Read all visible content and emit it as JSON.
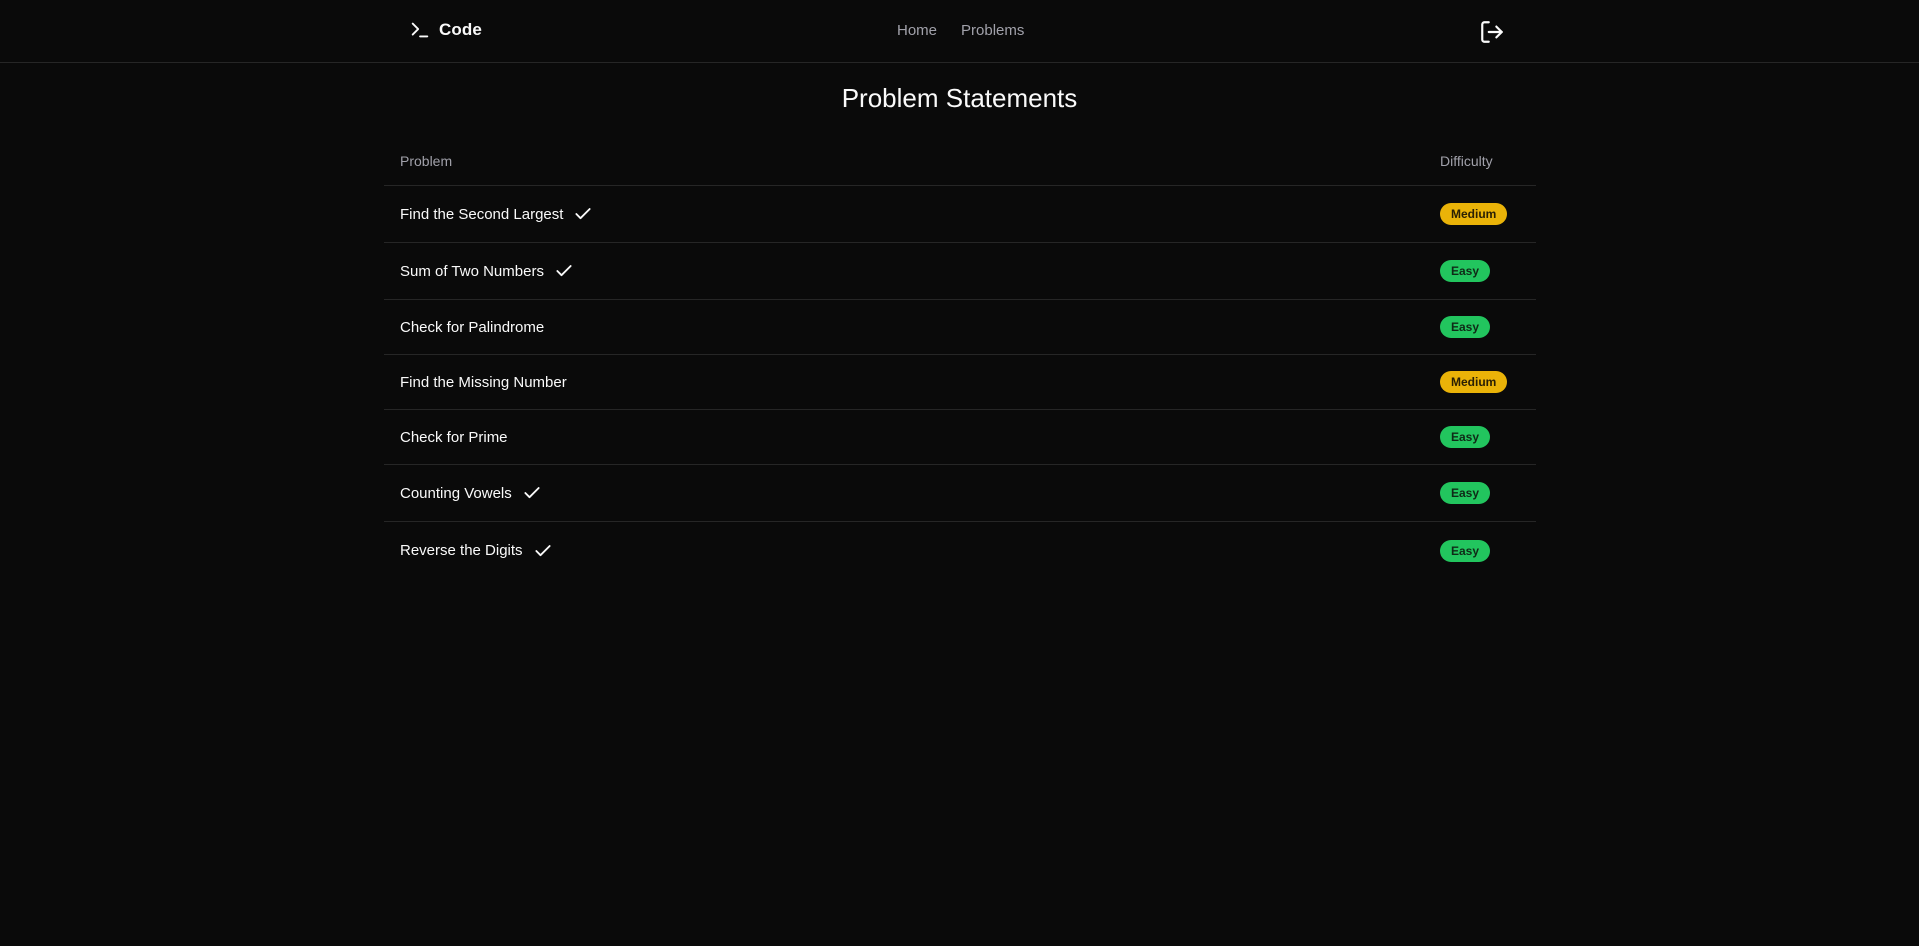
{
  "app": {
    "brand": "Code"
  },
  "nav": {
    "items": [
      {
        "label": "Home"
      },
      {
        "label": "Problems"
      }
    ]
  },
  "icons": {
    "brand": "terminal-icon",
    "logout": "logout-icon",
    "solved": "check-icon"
  },
  "page": {
    "title": "Problem Statements"
  },
  "table": {
    "headers": {
      "problem": "Problem",
      "difficulty": "Difficulty"
    },
    "rows": [
      {
        "title": "Find the Second Largest",
        "solved": true,
        "difficulty": "Medium"
      },
      {
        "title": "Sum of Two Numbers",
        "solved": true,
        "difficulty": "Easy"
      },
      {
        "title": "Check for Palindrome",
        "solved": false,
        "difficulty": "Easy"
      },
      {
        "title": "Find the Missing Number",
        "solved": false,
        "difficulty": "Medium"
      },
      {
        "title": "Check for Prime",
        "solved": false,
        "difficulty": "Easy"
      },
      {
        "title": "Counting Vowels",
        "solved": true,
        "difficulty": "Easy"
      },
      {
        "title": "Reverse the Digits",
        "solved": true,
        "difficulty": "Easy"
      }
    ]
  },
  "colors": {
    "background": "#0a0a0a",
    "border": "#262626",
    "muted_text": "#a1a1aa",
    "easy": "#22c55e",
    "medium": "#eab308"
  }
}
